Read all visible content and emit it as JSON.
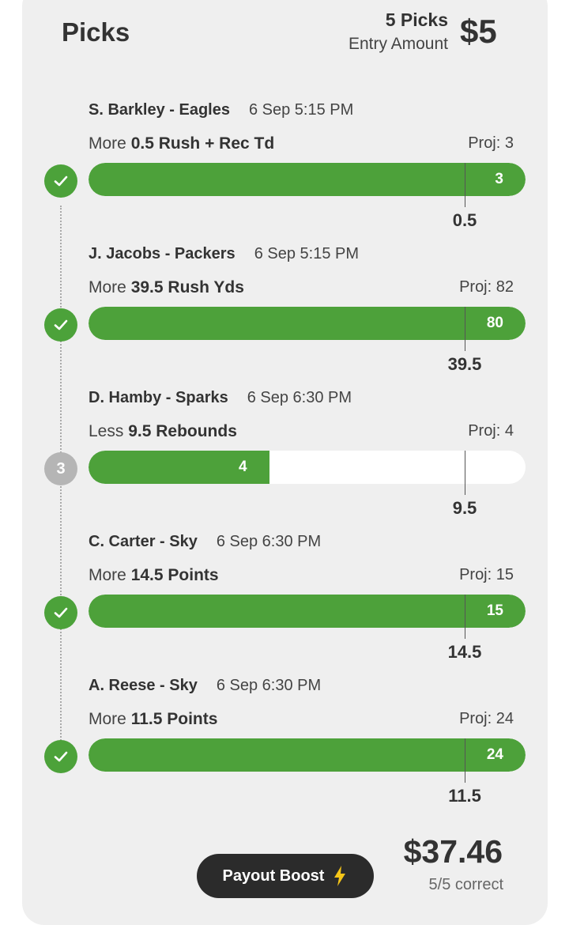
{
  "header": {
    "title": "Picks",
    "picks_count": "5 Picks",
    "entry_label": "Entry Amount",
    "entry_amount": "$5"
  },
  "picks": [
    {
      "player": "S. Barkley - Eagles",
      "time": "6 Sep 5:15 PM",
      "direction": "More",
      "stat": "0.5 Rush + Rec Td",
      "proj": "Proj: 3",
      "status": "won",
      "status_icon": "check-icon",
      "actual": "3",
      "actual_fraction": 1.0,
      "line": "0.5"
    },
    {
      "player": "J. Jacobs - Packers",
      "time": "6 Sep 5:15 PM",
      "direction": "More",
      "stat": "39.5 Rush Yds",
      "proj": "Proj: 82",
      "status": "won",
      "status_icon": "check-icon",
      "actual": "80",
      "actual_fraction": 1.0,
      "line": "39.5"
    },
    {
      "player": "D. Hamby - Sparks",
      "time": "6 Sep 6:30 PM",
      "direction": "Less",
      "stat": "9.5 Rebounds",
      "proj": "Proj: 4",
      "status": "pending",
      "status_label": "3",
      "actual": "4",
      "actual_fraction": 0.415,
      "line": "9.5"
    },
    {
      "player": "C. Carter - Sky",
      "time": "6 Sep 6:30 PM",
      "direction": "More",
      "stat": "14.5 Points",
      "proj": "Proj: 15",
      "status": "won",
      "status_icon": "check-icon",
      "actual": "15",
      "actual_fraction": 1.0,
      "line": "14.5"
    },
    {
      "player": "A. Reese - Sky",
      "time": "6 Sep 6:30 PM",
      "direction": "More",
      "stat": "11.5 Points",
      "proj": "Proj: 24",
      "status": "won",
      "status_icon": "check-icon",
      "actual": "24",
      "actual_fraction": 1.0,
      "line": "11.5"
    }
  ],
  "footer": {
    "payout_boost_label": "Payout Boost",
    "payout_icon": "lightning-bolt-icon",
    "payout_amount": "$37.46",
    "correct_text": "5/5 correct"
  },
  "colors": {
    "success": "#4ca23a",
    "pending": "#b5b5b5",
    "card_bg": "#efefef",
    "button_bg": "#2b2b2b",
    "bolt": "#f5c518"
  }
}
